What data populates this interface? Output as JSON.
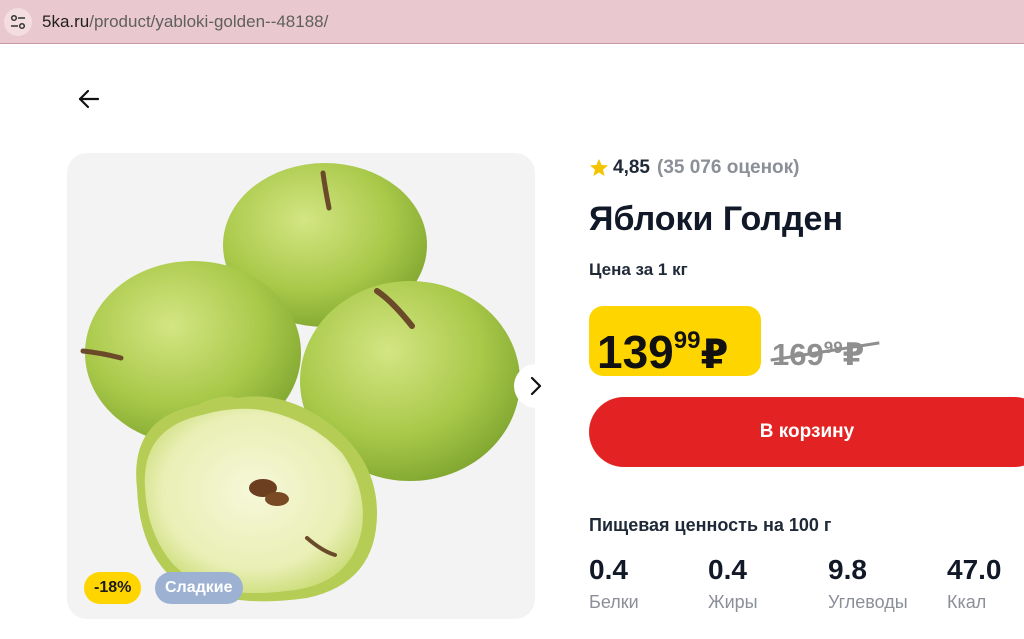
{
  "browser": {
    "url_domain": "5ka.ru",
    "url_path": "/product/yabloki-golden--48188/",
    "site_settings_icon": "tune-icon"
  },
  "nav": {
    "back_icon": "arrow-left-icon"
  },
  "gallery": {
    "next_icon": "chevron-right-icon",
    "badges": {
      "discount": "-18%",
      "tag": "Сладкие"
    }
  },
  "product": {
    "rating": {
      "score": "4,85",
      "count": "(35 076 оценок)",
      "star_color": "#f5c400"
    },
    "title": "Яблоки Голден",
    "unit_label": "Цена за 1 кг",
    "price": {
      "rub": "139",
      "kop": "99",
      "currency": "₽",
      "bg_color": "#ffd500"
    },
    "old_price": {
      "rub": "169",
      "kop": "99",
      "currency": "₽"
    },
    "cart_button": {
      "label": "В корзину",
      "color": "#e32323"
    }
  },
  "nutrition": {
    "title": "Пищевая ценность на 100 г",
    "items": [
      {
        "value": "0.4",
        "label": "Белки"
      },
      {
        "value": "0.4",
        "label": "Жиры"
      },
      {
        "value": "9.8",
        "label": "Углеводы"
      },
      {
        "value": "47.0",
        "label": "Ккал"
      }
    ]
  }
}
